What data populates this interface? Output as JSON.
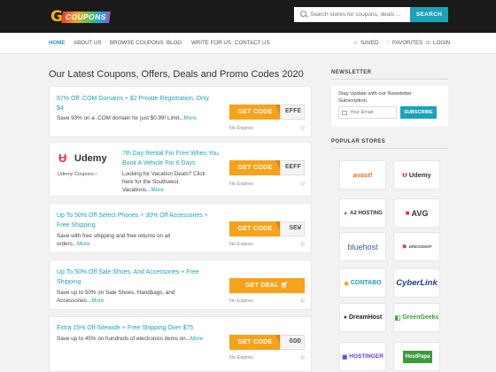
{
  "header": {
    "logo_text": "COUPONS",
    "search_placeholder": "Search stores for coupons, deals ...",
    "search_button": "SEARCH"
  },
  "nav": {
    "items": [
      {
        "label": "HOME",
        "active": true
      },
      {
        "label": "ABOUT US"
      },
      {
        "label": "BROWSE COUPONS"
      },
      {
        "label": "BLOG"
      },
      {
        "label": "WRITE FOR US"
      },
      {
        "label": "CONTACT US"
      }
    ],
    "right": [
      {
        "label": "SAVED",
        "icon": "star-outline-icon"
      },
      {
        "label": "FAVORITES",
        "icon": "heart-icon"
      },
      {
        "label": "LOGIN",
        "icon": "power-icon"
      }
    ]
  },
  "main": {
    "title": "Our Latest Coupons, Offers, Deals and Promo Codes 2020",
    "coupons": [
      {
        "title_1": "87% Off .COM Domains + $2 Private Registration, Only",
        "title_2": "$4",
        "desc_1": "Save 93% on a .COM domain for just $0.99! Limit...",
        "more": "More",
        "button": "GET CODE",
        "code": "EFFE",
        "expiry": "No Expires"
      },
      {
        "store": "Udemy",
        "caption": "Udemy Coupons",
        "title_1": "7th Day Rental For Free When You",
        "title_2": "Book A Vehicle For 6 Days",
        "desc_1": "Looking for Vacation Deals? Click",
        "desc_2": "here for the Southwest",
        "desc_3": "Vacations...",
        "more": "More",
        "button": "GET CODE",
        "code": "EEFF",
        "expiry": "No Expires"
      },
      {
        "title_1": "Up To 50% Off Select Phones + 30% Off Accessories +",
        "title_2": "Free Shipping",
        "desc_1": "Save with free shipping and free returns on all",
        "desc_2": "orders...",
        "more": "More",
        "button": "GET CODE",
        "code": "SEW",
        "expiry": "No Expires"
      },
      {
        "title_1": "Up To 50% Off Sale Shoes, And Accessories + Free",
        "title_2": "Shipping",
        "desc_1": "Save up to 50% on Sale Shoes, Handbags, and",
        "desc_2": "Accessories...",
        "more": "More",
        "button": "GET DEAL",
        "expiry": "No Expires"
      },
      {
        "title_1": "Extra 15% Off Sitewide + Free Shipping Over $75",
        "desc_1": "Save up to 45% on hundreds of electronics items on...",
        "more": "More",
        "button": "GET CODE",
        "code": "GDD",
        "expiry": "No Expires"
      }
    ]
  },
  "sidebar": {
    "newsletter_heading": "NEWSLETTER",
    "newsletter_text": "Stay Update with our Newsletter Subscription.",
    "newsletter_placeholder": "Your Email",
    "subscribe_button": "SUBSCRIBE",
    "stores_heading": "POPULAR STORES",
    "stores": [
      {
        "name": "avast!",
        "color": "#f26a1b"
      },
      {
        "name": "Udemy",
        "color": "#333333"
      },
      {
        "name": "A2 HOSTING",
        "color": "#333333"
      },
      {
        "name": "AVG",
        "color": "#333333"
      },
      {
        "name": "bluehost",
        "color": "#3b5998"
      },
      {
        "name": "DRESSMOP",
        "color": "#555555"
      },
      {
        "name": "CONTABO",
        "color": "#1ba3b8"
      },
      {
        "name": "CyberLink",
        "color": "#1a3f8a"
      },
      {
        "name": "DreamHost",
        "color": "#222222"
      },
      {
        "name": "GreenGeeks",
        "color": "#3c9c3c"
      },
      {
        "name": "HOSTINGER",
        "color": "#673de6"
      },
      {
        "name": "HostPapa",
        "color": "#3c9c3c"
      }
    ]
  }
}
